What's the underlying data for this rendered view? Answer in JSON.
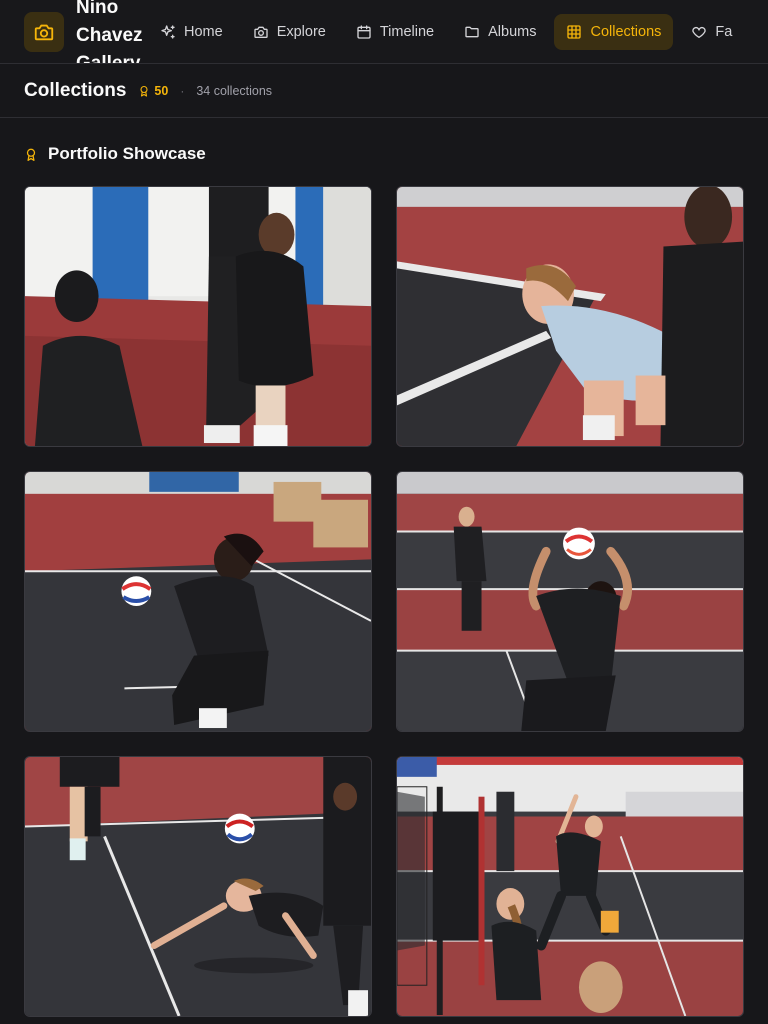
{
  "app": {
    "brand_name": "Nino Chavez Gallery"
  },
  "nav": {
    "items": [
      {
        "label": "Home",
        "icon": "sparkles-icon",
        "active": false
      },
      {
        "label": "Explore",
        "icon": "camera-icon",
        "active": false
      },
      {
        "label": "Timeline",
        "icon": "calendar-icon",
        "active": false
      },
      {
        "label": "Albums",
        "icon": "folder-icon",
        "active": false
      },
      {
        "label": "Collections",
        "icon": "grid-icon",
        "active": true
      },
      {
        "label": "Fa",
        "icon": "heart-icon",
        "active": false
      }
    ]
  },
  "header": {
    "title": "Collections",
    "badge_count": "50",
    "separator": "·",
    "collections_count": "34 collections"
  },
  "section": {
    "title": "Portfolio Showcase",
    "icon": "award-icon"
  },
  "photos": [
    {
      "subject": "volleyball players celebrating on red court"
    },
    {
      "subject": "player in light blue shirt leaning forward"
    },
    {
      "subject": "player bumping volleyball"
    },
    {
      "subject": "player setting volleyball overhead"
    },
    {
      "subject": "player diving for volleyball"
    },
    {
      "subject": "player jumping near net to spike"
    }
  ],
  "colors": {
    "accent": "#f5b50a",
    "background": "#17171a",
    "active_nav_bg": "#3a2f12"
  }
}
